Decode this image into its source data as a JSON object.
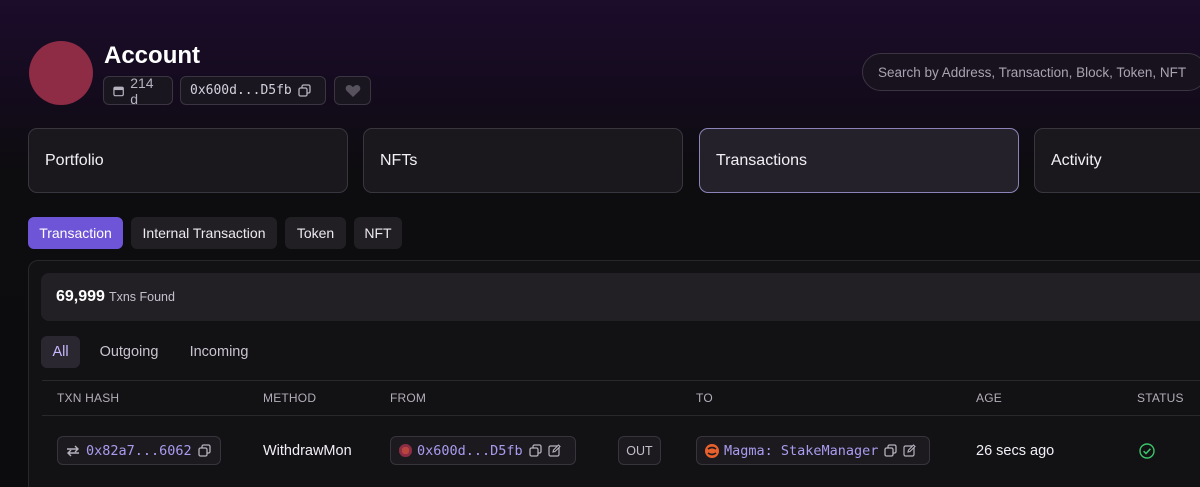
{
  "account": {
    "title": "Account",
    "age": "214 d",
    "address_short": "0x600d...D5fb"
  },
  "search": {
    "placeholder": "Search by Address, Transaction, Block, Token, NFT"
  },
  "main_tabs": [
    {
      "label": "Portfolio"
    },
    {
      "label": "NFTs"
    },
    {
      "label": "Transactions"
    },
    {
      "label": "Activity"
    }
  ],
  "sub_tabs": [
    {
      "label": "Transaction"
    },
    {
      "label": "Internal Transaction"
    },
    {
      "label": "Token"
    },
    {
      "label": "NFT"
    }
  ],
  "txns": {
    "count": "69,999",
    "count_label": "Txns Found"
  },
  "filters": [
    {
      "label": "All"
    },
    {
      "label": "Outgoing"
    },
    {
      "label": "Incoming"
    }
  ],
  "table": {
    "headers": [
      "TXN HASH",
      "METHOD",
      "FROM",
      "TO",
      "AGE",
      "STATUS"
    ],
    "rows": [
      {
        "hash": "0x82a7...6062",
        "method": "WithdrawMon",
        "from": "0x600d...D5fb",
        "direction": "OUT",
        "to": "Magma: StakeManager",
        "age": "26 secs ago",
        "status": "success"
      }
    ]
  },
  "colors": {
    "accent": "#6e54d6",
    "address_link": "#a99cf0",
    "success": "#3bc46a",
    "magma_brand": "#e8602c"
  },
  "icons": {
    "age": "calendar-icon",
    "copy": "copy-icon",
    "favorite": "heart-icon",
    "transfer": "swap-arrows-icon",
    "edit": "edit-icon",
    "status": "check-circle-icon"
  }
}
